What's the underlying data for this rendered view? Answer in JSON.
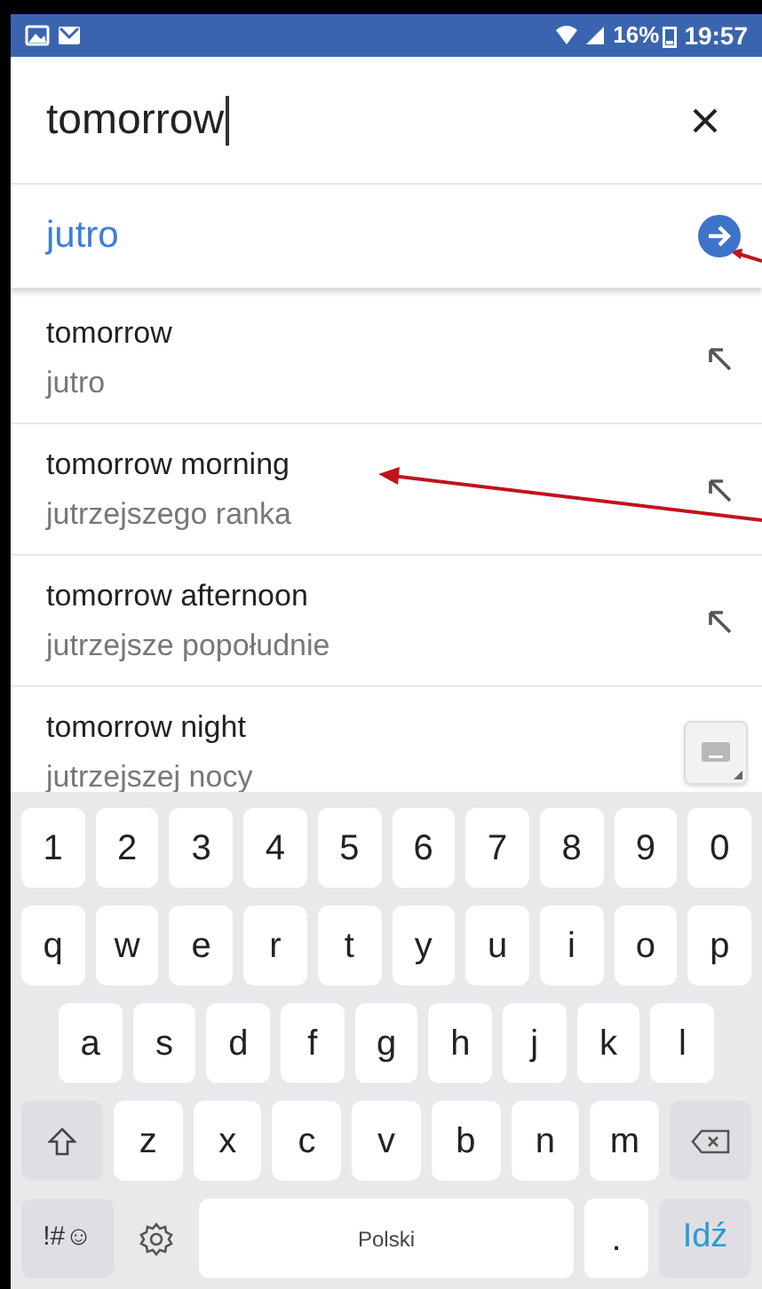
{
  "status_bar": {
    "battery": "16%",
    "time": "19:57"
  },
  "search": {
    "value": "tomorrow"
  },
  "translation": {
    "text": "jutro"
  },
  "suggestions": [
    {
      "text": "tomorrow",
      "translation": "jutro",
      "kind": "insert"
    },
    {
      "text": "tomorrow morning",
      "translation": "jutrzejszego ranka",
      "kind": "insert"
    },
    {
      "text": "tomorrow afternoon",
      "translation": "jutrzejsze popołudnie",
      "kind": "insert"
    },
    {
      "text": "tomorrow night",
      "translation": "jutrzejszej nocy",
      "kind": "keyboard"
    }
  ],
  "keyboard": {
    "rows": [
      {
        "keys": [
          {
            "kind": "char",
            "label": "1"
          },
          {
            "kind": "char",
            "label": "2"
          },
          {
            "kind": "char",
            "label": "3"
          },
          {
            "kind": "char",
            "label": "4"
          },
          {
            "kind": "char",
            "label": "5"
          },
          {
            "kind": "char",
            "label": "6"
          },
          {
            "kind": "char",
            "label": "7"
          },
          {
            "kind": "char",
            "label": "8"
          },
          {
            "kind": "char",
            "label": "9"
          },
          {
            "kind": "char",
            "label": "0"
          }
        ]
      },
      {
        "keys": [
          {
            "kind": "char",
            "label": "q"
          },
          {
            "kind": "char",
            "label": "w"
          },
          {
            "kind": "char",
            "label": "e"
          },
          {
            "kind": "char",
            "label": "r"
          },
          {
            "kind": "char",
            "label": "t"
          },
          {
            "kind": "char",
            "label": "y"
          },
          {
            "kind": "char",
            "label": "u"
          },
          {
            "kind": "char",
            "label": "i"
          },
          {
            "kind": "char",
            "label": "o"
          },
          {
            "kind": "char",
            "label": "p"
          }
        ]
      },
      {
        "keys": [
          {
            "kind": "char",
            "label": "a"
          },
          {
            "kind": "char",
            "label": "s"
          },
          {
            "kind": "char",
            "label": "d"
          },
          {
            "kind": "char",
            "label": "f"
          },
          {
            "kind": "char",
            "label": "g"
          },
          {
            "kind": "char",
            "label": "h"
          },
          {
            "kind": "char",
            "label": "j"
          },
          {
            "kind": "char",
            "label": "k"
          },
          {
            "kind": "char",
            "label": "l"
          }
        ]
      },
      {
        "keys": [
          {
            "kind": "shift"
          },
          {
            "kind": "char",
            "label": "z"
          },
          {
            "kind": "char",
            "label": "x"
          },
          {
            "kind": "char",
            "label": "c"
          },
          {
            "kind": "char",
            "label": "v"
          },
          {
            "kind": "char",
            "label": "b"
          },
          {
            "kind": "char",
            "label": "n"
          },
          {
            "kind": "char",
            "label": "m"
          },
          {
            "kind": "backspace"
          }
        ]
      },
      {
        "keys": [
          {
            "kind": "symbols",
            "label": "!#☺"
          },
          {
            "kind": "settings"
          },
          {
            "kind": "space",
            "label": "Polski"
          },
          {
            "kind": "char",
            "label": "."
          },
          {
            "kind": "go",
            "label": "Idź"
          }
        ]
      }
    ]
  }
}
